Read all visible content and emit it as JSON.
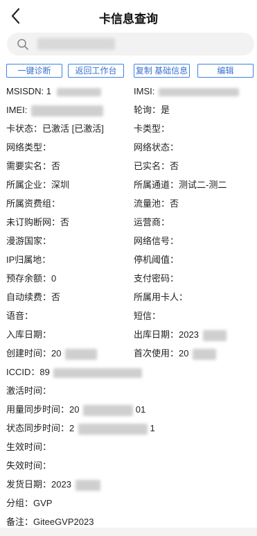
{
  "header": {
    "title": "卡信息查询"
  },
  "actions": [
    "一键诊断",
    "返回工作台",
    "复制 基础信息",
    "编辑"
  ],
  "fields": {
    "msisdn": "MSISDN: 1",
    "imsi": "IMSI:",
    "imei": "IMEI:",
    "polling": "轮询：是",
    "card_status": "卡状态：已激活 [已激活]",
    "card_type": "卡类型：",
    "network_type": "网络类型：",
    "network_status": "网络状态：",
    "need_realname": "需要实名：否",
    "realname_done": "已实名：否",
    "enterprise": "所属企业：深圳",
    "channel": "所属通道：测试二-测二",
    "tariff_group": "所属资费组：",
    "traffic_pool": "流量池：否",
    "unsub_cutoff": "未订购断网：否",
    "operator": "运营商：",
    "roaming": "漫游国家：",
    "signal": "网络信号：",
    "ip_location": "IP归属地：",
    "stop_threshold": "停机阈值：",
    "prepaid": "预存余额：0",
    "pay_password": "支付密码：",
    "auto_renew": "自动续费：否",
    "card_user": "所属用卡人：",
    "voice": "语音：",
    "sms": "短信：",
    "stock_in": "入库日期：",
    "stock_out": "出库日期：2023",
    "created": "创建时间：20",
    "first_use": "首次使用：20",
    "iccid": "ICCID：89",
    "activated_at": "激活时间：",
    "usage_sync": "用量同步时间：20",
    "usage_sync_tail": "01",
    "status_sync": "状态同步时间：2",
    "status_sync_tail": "1",
    "effective": "生效时间：",
    "expire": "失效时间：",
    "ship_date": "发货日期：2023",
    "group": "分组：GVP",
    "remark": "备注：GiteeGVP2023"
  }
}
